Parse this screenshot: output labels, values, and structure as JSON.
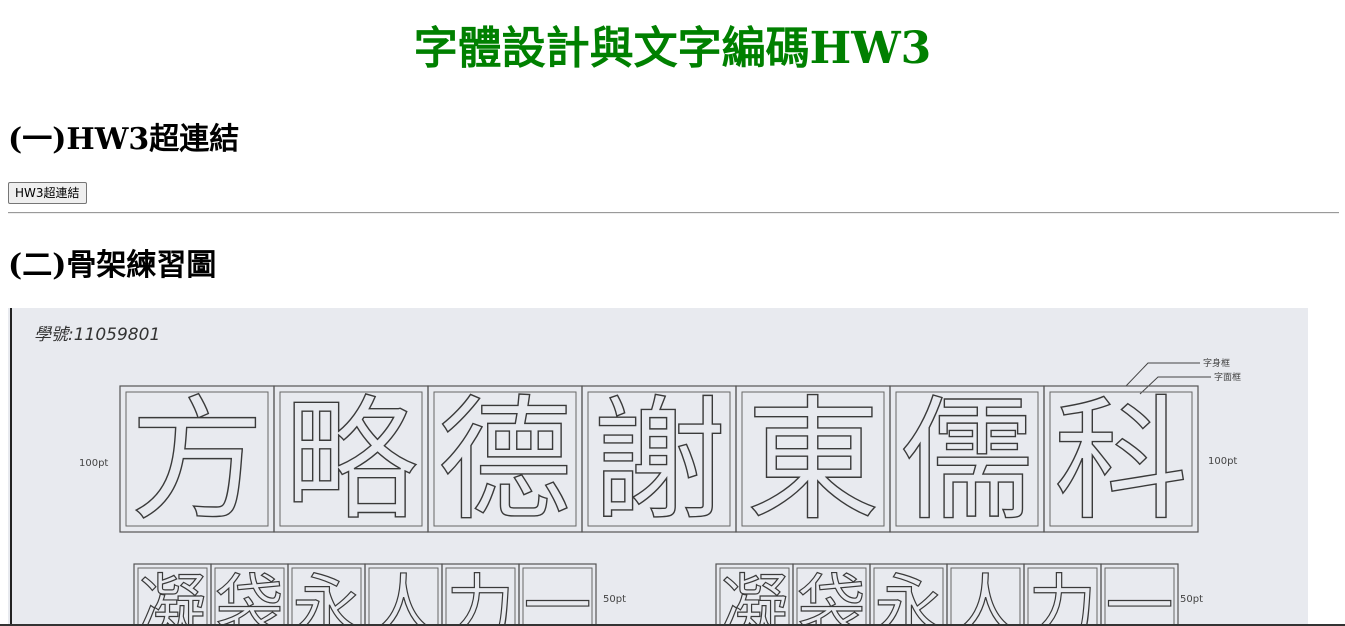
{
  "page": {
    "title": "字體設計與文字編碼HW3",
    "title_color": "#008000"
  },
  "section1": {
    "heading": "(一)HW3超連結",
    "button_label": "HW3超連結"
  },
  "section2": {
    "heading": "(二)骨架練習圖"
  },
  "practice_sheet": {
    "student_id": "學號:11059801",
    "label_frame_body": "字身框",
    "label_frame_face": "字面框",
    "size_large_left": "100pt",
    "size_large_right": "100pt",
    "size_small_1": "50pt",
    "size_small_2": "50pt",
    "large_chars": [
      "方",
      "略",
      "德",
      "謝",
      "東",
      "儒",
      "科"
    ],
    "small_chars_left": [
      "凝",
      "袋",
      "永",
      "人",
      "力",
      "一"
    ],
    "small_chars_right": [
      "凝",
      "袋",
      "永",
      "人",
      "力",
      "一"
    ]
  }
}
